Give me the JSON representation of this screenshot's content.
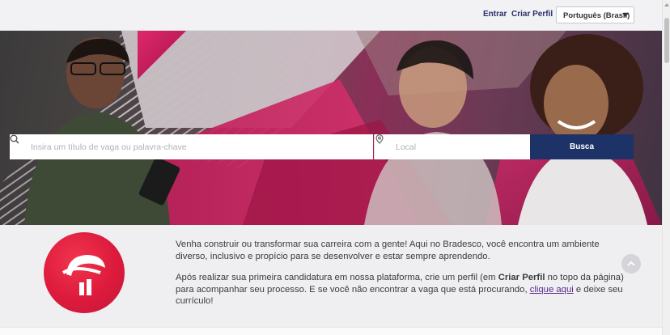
{
  "header": {
    "login_label": "Entrar",
    "create_profile_label": "Criar Perfil",
    "language_selected": "Português (Brasil)"
  },
  "search": {
    "keyword_placeholder": "Insira um título de vaga ou palavra-chave",
    "location_placeholder": "Local",
    "button_label": "Busca"
  },
  "intro": {
    "paragraph1": "Venha construir ou transformar sua carreira com a gente! Aqui no Bradesco, você encontra um ambiente diverso, inclusivo e propício para se desenvolver e estar sempre aprendendo.",
    "paragraph2_part1": "Após realizar sua primeira candidatura em nossa plataforma, crie um perfil (em ",
    "paragraph2_bold": "Criar Perfil",
    "paragraph2_part2": " no topo da página) para acompanhar seu processo. E se você não encontrar a vaga que está procurando, ",
    "paragraph2_link": "clique aqui",
    "paragraph2_part3": " e deixe seu currículo!"
  },
  "colors": {
    "brand_red": "#dd1a3c",
    "button_navy": "#1d3266",
    "link_navy": "#2b2f6a",
    "magenta": "#c4125a"
  },
  "icons": {
    "search": "search-icon",
    "location": "location-pin-icon",
    "logo": "bradesco-logo-icon",
    "scroll_top": "chevron-up-icon",
    "dropdown": "caret-down-icon"
  }
}
